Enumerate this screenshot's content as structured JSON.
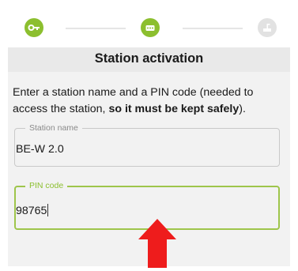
{
  "stepper": {
    "steps": [
      {
        "icon": "key-icon",
        "state": "completed",
        "color": "#8cbf2f"
      },
      {
        "icon": "dialpad-icon",
        "state": "active",
        "color": "#8cbf2f"
      },
      {
        "icon": "station-icon",
        "state": "pending",
        "color": "#e2e2e2"
      }
    ]
  },
  "panel": {
    "title": "Station activation",
    "description_prefix": "Enter a station name and a PIN code (needed to access the station, ",
    "description_bold": "so it must be kept safely",
    "description_suffix": ")."
  },
  "fields": {
    "station_name": {
      "label": "Station name",
      "value": "BE-W 2.0"
    },
    "pin_code": {
      "label": "PIN code",
      "value": "98765",
      "focused": true
    }
  },
  "annotation": {
    "icon": "red-arrow-icon",
    "color": "#ee1c1c"
  },
  "colors": {
    "accent": "#8cbf2f",
    "panel_bg": "#f2f2f2",
    "header_bg": "#e9e9e9"
  }
}
